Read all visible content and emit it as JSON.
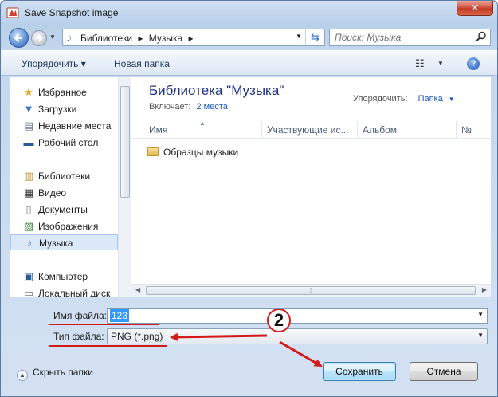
{
  "window": {
    "title": "Save Snapshot image",
    "close_symbol": "✕"
  },
  "nav": {
    "breadcrumbs": [
      "Библиотеки",
      "▸",
      "Музыка",
      "▸"
    ]
  },
  "search": {
    "placeholder": "Поиск: Музыка"
  },
  "toolbar": {
    "organize": "Упорядочить ▾",
    "new_folder": "Новая папка",
    "help": "?"
  },
  "sidebar": {
    "items": [
      {
        "label": "Избранное",
        "icon": "star-icon",
        "glyph": "★"
      },
      {
        "label": "Загрузки",
        "icon": "downloads-folder-icon",
        "glyph": "▼"
      },
      {
        "label": "Недавние места",
        "icon": "recent-places-icon",
        "glyph": "▤"
      },
      {
        "label": "Рабочий стол",
        "icon": "desktop-icon",
        "glyph": "▬"
      },
      {
        "label": "Библиотеки",
        "icon": "libraries-icon",
        "glyph": "▥"
      },
      {
        "label": "Видео",
        "icon": "video-icon",
        "glyph": "▦"
      },
      {
        "label": "Документы",
        "icon": "documents-icon",
        "glyph": "▯"
      },
      {
        "label": "Изображения",
        "icon": "pictures-icon",
        "glyph": "▨"
      },
      {
        "label": "Музыка",
        "icon": "music-icon",
        "glyph": "♪"
      },
      {
        "label": "Компьютер",
        "icon": "computer-icon",
        "glyph": "▣"
      },
      {
        "label": "Локальный диск",
        "icon": "local-disk-icon",
        "glyph": "▭"
      }
    ]
  },
  "library": {
    "title": "Библиотека \"Музыка\"",
    "includes_label": "Включает:",
    "includes_link": "2 места",
    "arrange_label": "Упорядочить:",
    "arrange_value": "Папка"
  },
  "columns": [
    "Имя",
    "Участвующие ис...",
    "Альбом",
    "№"
  ],
  "files": [
    {
      "name": "Образцы музыки"
    }
  ],
  "form": {
    "filename_label": "Имя файла:",
    "filename_value": "123",
    "filetype_label": "Тип файла:",
    "filetype_value": "PNG (*.png)"
  },
  "annotation": {
    "step": "2",
    "color": "#d41b1b"
  },
  "footer": {
    "hide_folders": "Скрыть папки",
    "save": "Сохранить",
    "cancel": "Отмена"
  }
}
